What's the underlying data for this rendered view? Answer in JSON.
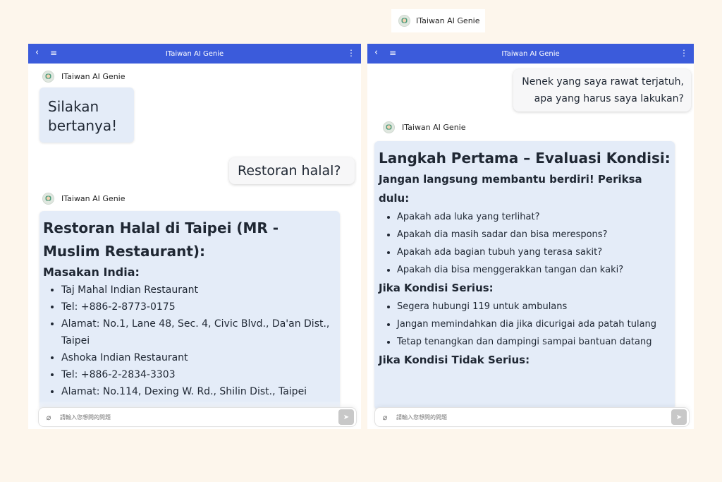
{
  "badge": {
    "name": "ITaiwan AI Genie"
  },
  "left": {
    "app_title": "ITaiwan AI Genie",
    "sender1": "ITaiwan AI Genie",
    "greeting": "Silakan bertanya!",
    "user_msg": "Restoran halal?",
    "sender2": "ITaiwan AI Genie",
    "answer": {
      "heading": "Restoran Halal di Taipei (MR - Muslim Restaurant):",
      "subheading": "Masakan India:",
      "items": [
        "Taj Mahal Indian Restaurant",
        "Tel: +886-2-8773-0175",
        "Alamat: No.1, Lane 48, Sec. 4, Civic Blvd., Da'an Dist., Taipei",
        "Ashoka Indian Restaurant",
        "Tel: +886-2-2834-3303",
        "Alamat: No.114, Dexing W. Rd., Shilin Dist., Taipei"
      ]
    },
    "input_placeholder": "請輸入您想問的問題"
  },
  "right": {
    "app_title": "ITaiwan AI Genie",
    "user_msg": "Nenek yang saya rawat terjatuh, apa yang harus saya lakukan?",
    "sender": "ITaiwan AI Genie",
    "answer": {
      "heading": "Langkah Pertama – Evaluasi Kondisi:",
      "intro": "Jangan langsung membantu berdiri! Periksa dulu:",
      "check_items": [
        "Apakah ada luka yang terlihat?",
        "Apakah dia masih sadar dan bisa merespons?",
        "Apakah ada bagian tubuh yang terasa sakit?",
        "Apakah dia bisa menggerakkan tangan dan kaki?"
      ],
      "serious_heading": "Jika Kondisi Serius:",
      "serious_items": [
        "Segera hubungi 119 untuk ambulans",
        "Jangan memindahkan dia jika dicurigai ada patah tulang",
        "Tetap tenangkan dan dampingi sampai bantuan datang"
      ],
      "not_serious_heading": "Jika Kondisi Tidak Serius:"
    },
    "input_placeholder": "請輸入您想問的問題"
  },
  "colors": {
    "appbar": "#3b5bdb",
    "bot_bubble": "#e4ecf8",
    "background": "#fdf6ec"
  },
  "icons": [
    "back-arrow-icon",
    "hamburger-menu-icon",
    "more-vertical-icon",
    "paperclip-icon",
    "send-icon",
    "avatar-icon"
  ]
}
